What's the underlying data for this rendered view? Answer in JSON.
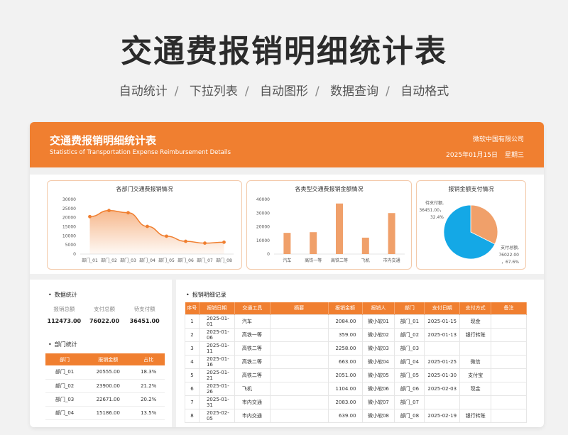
{
  "hero": {
    "title": "交通费报销明细统计表",
    "features": [
      "自动统计",
      "下拉列表",
      "自动图形",
      "数据查询",
      "自动格式"
    ],
    "separator": "/"
  },
  "banner": {
    "title": "交通费报销明细统计表",
    "subtitle": "Statistics of Transportation Expense Reimbursement Details",
    "company": "微软中国有限公司",
    "date": "2025年01月15日",
    "weekday": "星期三"
  },
  "chart_data": [
    {
      "type": "area",
      "title": "各部门交通费报销情况",
      "categories": [
        "部门_01",
        "部门_02",
        "部门_03",
        "部门_04",
        "部门_05",
        "部门_06",
        "部门_07",
        "部门_08"
      ],
      "values": [
        20555,
        23900,
        22671,
        15186,
        9800,
        7000,
        6000,
        6500
      ],
      "ylim": [
        0,
        30000
      ],
      "yticks": [
        0,
        5000,
        10000,
        15000,
        20000,
        25000,
        30000
      ],
      "color": "#f07f30"
    },
    {
      "type": "bar",
      "title": "各类型交通费报销金额情况",
      "categories": [
        "汽车",
        "高铁一等",
        "高铁二等",
        "飞机",
        "市内交通"
      ],
      "values": [
        15500,
        16000,
        37000,
        12000,
        30000
      ],
      "ylim": [
        0,
        40000
      ],
      "yticks": [
        0,
        10000,
        20000,
        30000,
        40000
      ],
      "color": "#f0a06a"
    },
    {
      "type": "pie",
      "title": "报销金额支付情况",
      "slices": [
        {
          "name": "待支付额",
          "value": 36451.0,
          "label": "待支付额,\n36451.00，\n32.4%",
          "color": "#f0a06a"
        },
        {
          "name": "支付总额",
          "value": 76022.0,
          "label": "支付总额,\n76022.00\n，67.6%",
          "color": "#14a8e6"
        }
      ]
    }
  ],
  "stats": {
    "section_title": "数据统计",
    "labels": [
      "报销总额",
      "支付总额",
      "待支付额"
    ],
    "values": [
      "112473.00",
      "76022.00",
      "36451.00"
    ]
  },
  "dept": {
    "section_title": "部门统计",
    "headers": [
      "部门",
      "报销金额",
      "占比"
    ],
    "rows": [
      [
        "部门_01",
        "20555.00",
        "18.3%"
      ],
      [
        "部门_02",
        "23900.00",
        "21.2%"
      ],
      [
        "部门_03",
        "22671.00",
        "20.2%"
      ],
      [
        "部门_04",
        "15186.00",
        "13.5%"
      ]
    ]
  },
  "detail": {
    "section_title": "报销明细记录",
    "headers": [
      "序号",
      "报销日期",
      "交通工具",
      "摘要",
      "报销金额",
      "报销人",
      "部门",
      "支付日期",
      "支付方式",
      "备注"
    ],
    "rows": [
      [
        "1",
        "2025-01-01",
        "汽车",
        "",
        "2084.00",
        "微小软01",
        "部门_01",
        "2025-01-15",
        "现金",
        ""
      ],
      [
        "2",
        "2025-01-06",
        "高铁一等",
        "",
        "359.00",
        "微小软02",
        "部门_02",
        "2025-01-13",
        "银行转账",
        ""
      ],
      [
        "3",
        "2025-01-11",
        "高铁二等",
        "",
        "2258.00",
        "微小软03",
        "部门_03",
        "",
        "",
        ""
      ],
      [
        "4",
        "2025-01-16",
        "高铁二等",
        "",
        "663.00",
        "微小软04",
        "部门_04",
        "2025-01-25",
        "微信",
        ""
      ],
      [
        "5",
        "2025-01-21",
        "高铁二等",
        "",
        "2051.00",
        "微小软05",
        "部门_05",
        "2025-01-30",
        "支付宝",
        ""
      ],
      [
        "6",
        "2025-01-26",
        "飞机",
        "",
        "1104.00",
        "微小软06",
        "部门_06",
        "2025-02-03",
        "现金",
        ""
      ],
      [
        "7",
        "2025-01-31",
        "市内交通",
        "",
        "2083.00",
        "微小软07",
        "部门_07",
        "",
        "",
        ""
      ],
      [
        "8",
        "2025-02-05",
        "市内交通",
        "",
        "639.00",
        "微小软08",
        "部门_08",
        "2025-02-19",
        "银行转账",
        ""
      ]
    ]
  }
}
